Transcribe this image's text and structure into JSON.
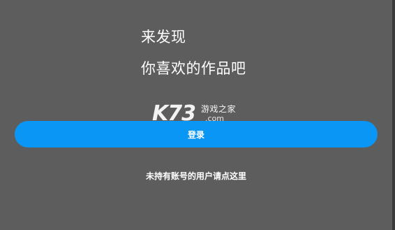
{
  "headline": {
    "line1": "来发现",
    "line2": "你喜欢的作品吧"
  },
  "watermark": {
    "logo": "K73",
    "site_name": "游戏之家",
    "domain": ".com"
  },
  "login_button": {
    "label": "登录"
  },
  "no_account_link": {
    "label": "未持有账号的用户请点这里"
  },
  "colors": {
    "background": "#5d5d5d",
    "button": "#0a96f4",
    "text": "#ffffff"
  }
}
